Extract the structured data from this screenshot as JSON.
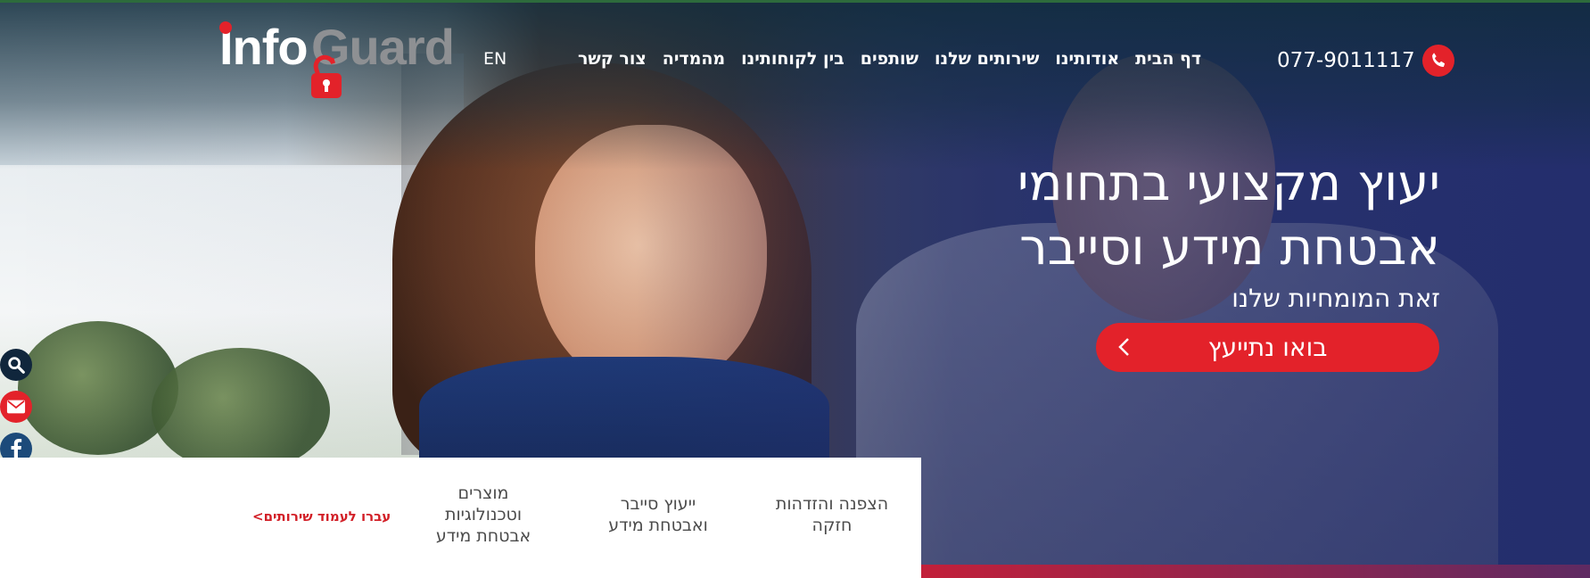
{
  "logo": {
    "text_info": "Info",
    "text_guard": "Guard"
  },
  "header": {
    "lang": "EN",
    "phone": "077-9011117",
    "nav": [
      {
        "label": "דף הבית"
      },
      {
        "label": "אודותינו"
      },
      {
        "label": "שירותים שלנו"
      },
      {
        "label": "שותפים"
      },
      {
        "label": "בין לקוחותינו"
      },
      {
        "label": "מהמדיה"
      },
      {
        "label": "צור קשר"
      }
    ]
  },
  "hero": {
    "title_line1": "יעוץ מקצועי בתחומי",
    "title_line2": "אבטחת מידע וסייבר",
    "subtitle": "זאת המומחיות שלנו",
    "cta": "בואו נתייעץ"
  },
  "services": {
    "items": [
      {
        "line1": "הצפנה והזדהות",
        "line2": "חזקה",
        "line3": ""
      },
      {
        "line1": "ייעוץ סייבר",
        "line2": "ואבטחת מידע",
        "line3": ""
      },
      {
        "line1": "מוצרים",
        "line2": "וטכנולוגיות",
        "line3": "אבטחת מידע"
      }
    ],
    "link": "עברו לעמוד שירותים>"
  },
  "side_icons": [
    "search-icon",
    "mail-icon",
    "facebook-icon",
    "linkedin-icon"
  ],
  "colors": {
    "accent": "#e3222a",
    "nav_text": "#ffffff",
    "service_text": "#4b4b4b",
    "link_red": "#d21f27"
  }
}
